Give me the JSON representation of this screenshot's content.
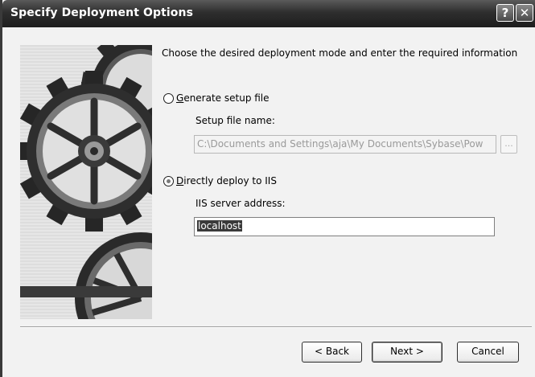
{
  "window": {
    "title": "Specify Deployment Options",
    "help_icon": "help-icon",
    "close_icon": "close-icon"
  },
  "description": "Choose the desired deployment mode and enter the required information",
  "options": {
    "generate": {
      "mnemonic": "G",
      "rest": "enerate setup file",
      "selected": false,
      "field_label": "Setup file name:",
      "field_value": "C:\\Documents and Settings\\aja\\My Documents\\Sybase\\Pow",
      "enabled": false,
      "browse_label": "..."
    },
    "deploy": {
      "mnemonic": "D",
      "rest": "irectly deploy to IIS",
      "selected": true,
      "field_label": "IIS server address:",
      "field_value": "localhost",
      "enabled": true
    }
  },
  "buttons": {
    "back": "< Back",
    "next": "Next >",
    "cancel": "Cancel"
  },
  "colors": {
    "titlebar": "#2e2e2e",
    "selection": "#3a3a3a"
  }
}
